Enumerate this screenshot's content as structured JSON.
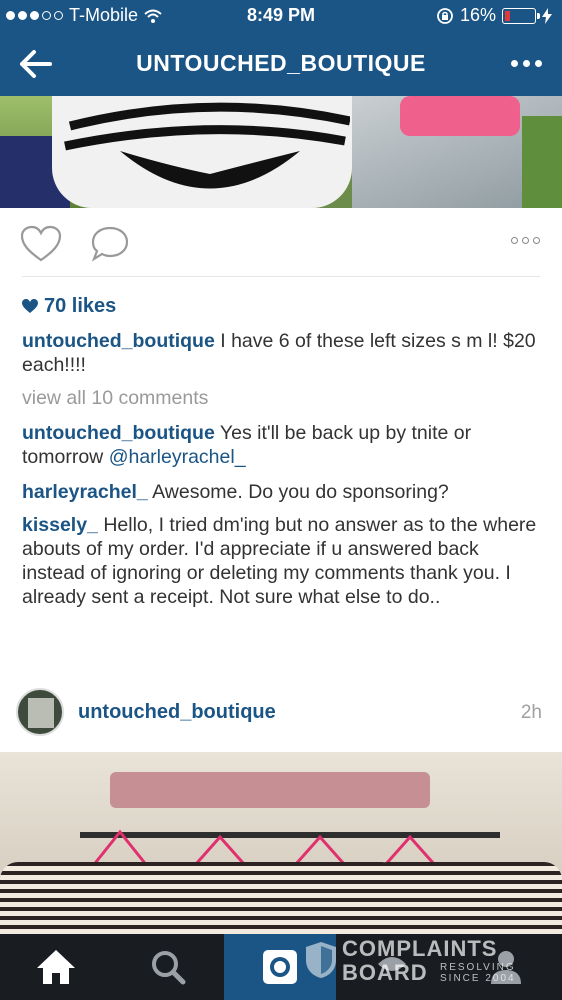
{
  "status_bar": {
    "carrier": "T-Mobile",
    "time": "8:49 PM",
    "battery": "16%",
    "battery_level": 0.16
  },
  "header": {
    "title": "UNTOUCHED_BOUTIQUE"
  },
  "post1": {
    "likes": "70 likes",
    "caption_user": "untouched_boutique",
    "caption_text": " I have 6 of these left sizes s m l! $20 each!!!!",
    "view_all": "view all 10 comments",
    "comments": [
      {
        "user": "untouched_boutique",
        "text": " Yes it'll be back up by tnite or tomorrow ",
        "mention": "@harleyrachel_"
      },
      {
        "user": "harleyrachel_",
        "text": " Awesome. Do you do sponsoring?",
        "mention": ""
      },
      {
        "user": "kissely_",
        "text": " Hello, I tried dm'ing but no answer as to the where abouts of my order. I'd appreciate if u answered back instead of ignoring or deleting my comments thank you. I already sent a receipt. Not sure what else to do..",
        "mention": ""
      }
    ]
  },
  "post2": {
    "username": "untouched_boutique",
    "age": "2h"
  },
  "tab_bar": {
    "tabs": [
      "home-icon",
      "search-icon",
      "camera-icon",
      "activity-icon",
      "profile-icon"
    ]
  },
  "watermark": {
    "line1": "COMPLAINTS",
    "line2": "BOARD",
    "line3": "RESOLVING",
    "line4": "SINCE 2004"
  },
  "colors": {
    "brand": "#1b5585",
    "tabbar": "#191d22"
  }
}
